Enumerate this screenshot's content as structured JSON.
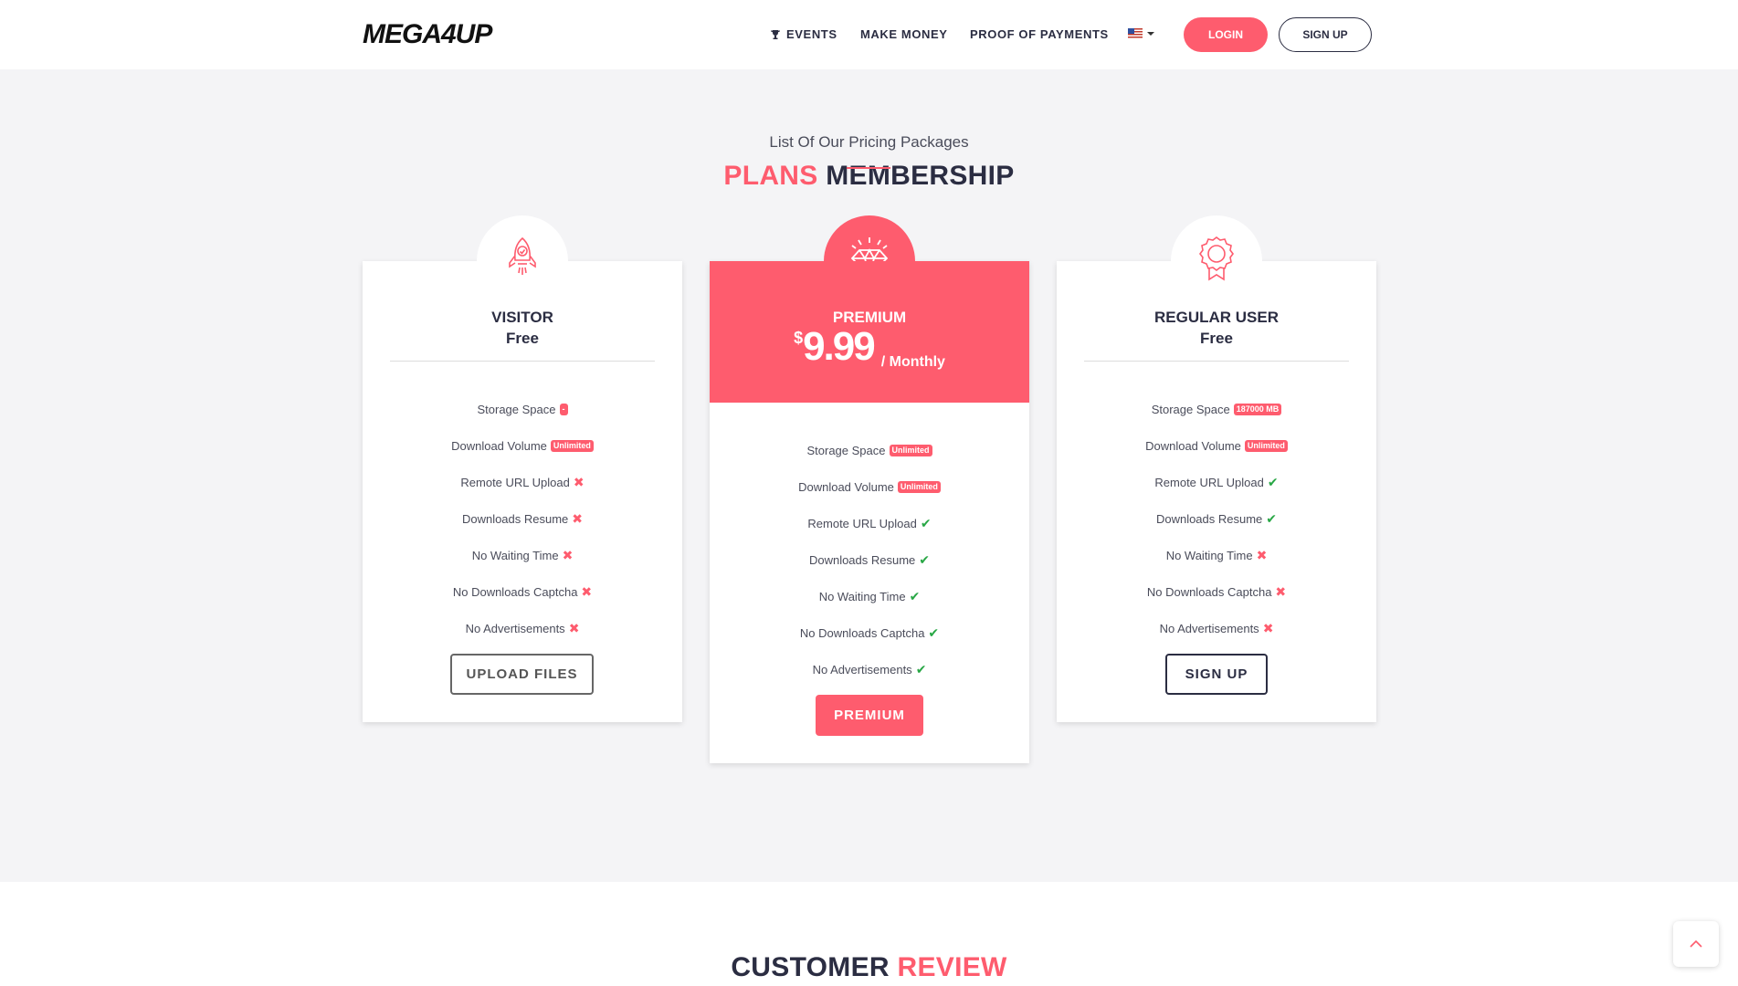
{
  "header": {
    "logo_text": "MEGA4UP",
    "nav": {
      "events": "EVENTS",
      "make_money": "MAKE MONEY",
      "proof": "PROOF OF PAYMENTS"
    },
    "language_icon": "us-flag-icon",
    "login": "LOGIN",
    "signup": "SIGN UP"
  },
  "pricing": {
    "title_accent": "PLANS",
    "title_rest": "MEMBERSHIP",
    "subtitle": "List Of Our Pricing Packages",
    "plans": [
      {
        "name": "VISITOR",
        "price": "Free",
        "features": [
          {
            "label": "Storage Space",
            "tag": "-"
          },
          {
            "label": "Download Volume",
            "tag": "Unlimited"
          },
          {
            "label": "Remote URL Upload",
            "status": "no"
          },
          {
            "label": "Downloads Resume",
            "status": "no"
          },
          {
            "label": "No Waiting Time",
            "status": "no"
          },
          {
            "label": "No Downloads Captcha",
            "status": "no"
          },
          {
            "label": "No Advertisements",
            "status": "no"
          }
        ],
        "button": "UPLOAD FILES"
      },
      {
        "name": "PREMIUM",
        "currency": "$",
        "amount": "9.99",
        "period": "/ Monthly",
        "features": [
          {
            "label": "Storage Space",
            "tag": "Unlimited"
          },
          {
            "label": "Download Volume",
            "tag": "Unlimited"
          },
          {
            "label": "Remote URL Upload",
            "status": "yes"
          },
          {
            "label": "Downloads Resume",
            "status": "yes"
          },
          {
            "label": "No Waiting Time",
            "status": "yes"
          },
          {
            "label": "No Downloads Captcha",
            "status": "yes"
          },
          {
            "label": "No Advertisements",
            "status": "yes"
          }
        ],
        "button": "PREMIUM"
      },
      {
        "name": "REGULAR USER",
        "price": "Free",
        "features": [
          {
            "label": "Storage Space",
            "tag": "187000 MB"
          },
          {
            "label": "Download Volume",
            "tag": "Unlimited"
          },
          {
            "label": "Remote URL Upload",
            "status": "yes"
          },
          {
            "label": "Downloads Resume",
            "status": "yes"
          },
          {
            "label": "No Waiting Time",
            "status": "no"
          },
          {
            "label": "No Downloads Captcha",
            "status": "no"
          },
          {
            "label": "No Advertisements",
            "status": "no"
          }
        ],
        "button": "SIGN UP"
      }
    ]
  },
  "review": {
    "title_rest": "CUSTOMER",
    "title_accent": "REVIEW"
  },
  "colors": {
    "accent": "#fe5c6e",
    "success": "#28a745",
    "dark": "#2b2d42"
  }
}
